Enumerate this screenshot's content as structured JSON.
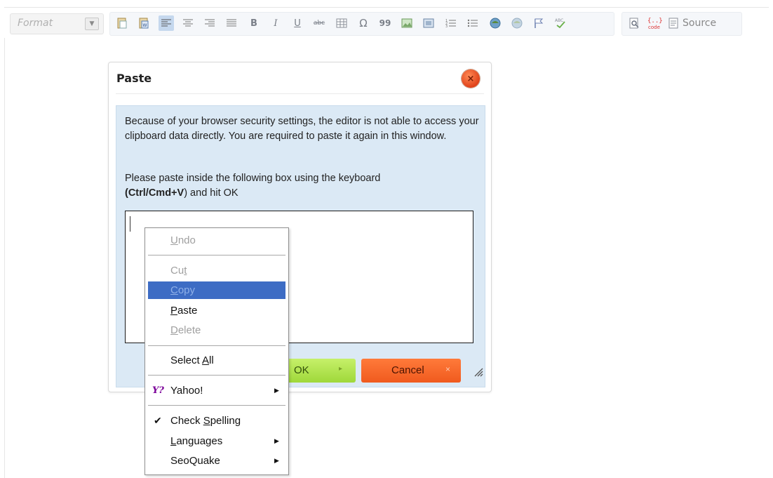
{
  "toolbar": {
    "format_label": "Format",
    "format_arrow": "▼",
    "source_label": "Source",
    "source_icon": "source-icon",
    "buttons": [
      {
        "name": "paste-text-icon"
      },
      {
        "name": "paste-word-icon"
      },
      {
        "name": "align-left-icon",
        "active": true
      },
      {
        "name": "align-center-icon"
      },
      {
        "name": "align-right-icon"
      },
      {
        "name": "align-justify-icon"
      },
      {
        "name": "bold-icon",
        "glyph": "B"
      },
      {
        "name": "italic-icon",
        "glyph": "I"
      },
      {
        "name": "underline-icon",
        "glyph": "U"
      },
      {
        "name": "strikethrough-icon",
        "glyph": "abc"
      },
      {
        "name": "table-icon"
      },
      {
        "name": "special-char-icon",
        "glyph": "Ω"
      },
      {
        "name": "blockquote-icon",
        "glyph": "99"
      },
      {
        "name": "image-icon"
      },
      {
        "name": "flash-icon"
      },
      {
        "name": "numbered-list-icon"
      },
      {
        "name": "bulleted-list-icon"
      },
      {
        "name": "link-icon"
      },
      {
        "name": "unlink-icon"
      },
      {
        "name": "anchor-icon"
      },
      {
        "name": "spellcheck-icon",
        "glyph": "ABC"
      },
      {
        "name": "preview-icon"
      },
      {
        "name": "code-snippet-icon",
        "glyph": "code"
      }
    ]
  },
  "dialog": {
    "title": "Paste",
    "close_glyph": "×",
    "message_1": "Because of your browser security settings, the editor is not able to access your clipboard data directly. You are required to paste it again in this window.",
    "message_2_pre": "Please paste inside the following box using the keyboard",
    "message_2_shortcut": "(Ctrl/Cmd+V",
    "message_2_post": ") and hit OK",
    "paste_value": "",
    "ok_label": "OK",
    "ok_arrow": "▸",
    "cancel_label": "Cancel",
    "cancel_glyph": "×"
  },
  "context_menu": {
    "items": [
      {
        "label": "Undo",
        "u": "U",
        "rest": "ndo",
        "disabled": true
      },
      {
        "label": "Cut",
        "pre": "Cu",
        "u": "t",
        "rest": "",
        "disabled": true
      },
      {
        "label": "Copy",
        "u": "C",
        "rest": "opy",
        "disabled": true,
        "highlight": true
      },
      {
        "label": "Paste",
        "u": "P",
        "rest": "aste",
        "disabled": false
      },
      {
        "label": "Delete",
        "u": "D",
        "rest": "elete",
        "disabled": true
      },
      {
        "label": "Select All",
        "pre": "Select ",
        "u": "A",
        "rest": "ll"
      },
      {
        "label": "Yahoo!",
        "icon": "yahoo-icon",
        "icon_glyph": "Y?",
        "submenu": true
      },
      {
        "label": "Check Spelling",
        "pre": "Check ",
        "u": "S",
        "rest": "pelling",
        "checked": true
      },
      {
        "label": "Languages",
        "u": "L",
        "rest": "anguages",
        "submenu": true
      },
      {
        "label": "SeoQuake",
        "submenu": true
      }
    ],
    "check_glyph": "✔",
    "submenu_glyph": "▶"
  }
}
